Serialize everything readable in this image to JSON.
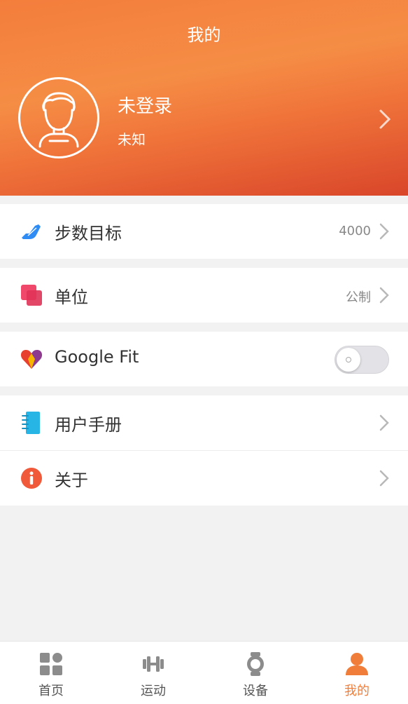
{
  "header": {
    "title": "我的",
    "user_name": "未登录",
    "user_sub": "未知"
  },
  "settings": [
    {
      "label": "步数目标",
      "value": "4000",
      "icon": "running-shoe-icon",
      "color": "#2f8cf5"
    },
    {
      "label": "单位",
      "value": "公制",
      "icon": "unit-squares-icon",
      "color": "#f0486a"
    },
    {
      "label": "Google Fit",
      "toggle": false,
      "icon": "google-fit-heart-icon"
    },
    {
      "label": "用户手册",
      "icon": "manual-book-icon",
      "color": "#27b5e6"
    },
    {
      "label": "关于",
      "icon": "info-icon",
      "color": "#f05a3a"
    }
  ],
  "tabs": [
    {
      "label": "首页",
      "icon": "home-grid-icon"
    },
    {
      "label": "运动",
      "icon": "dumbbell-icon"
    },
    {
      "label": "设备",
      "icon": "watch-icon"
    },
    {
      "label": "我的",
      "icon": "person-icon",
      "active": true
    }
  ],
  "colors": {
    "accent": "#f07e3a",
    "header_gradient_start": "#f47d3c",
    "header_gradient_end": "#d9462a"
  }
}
